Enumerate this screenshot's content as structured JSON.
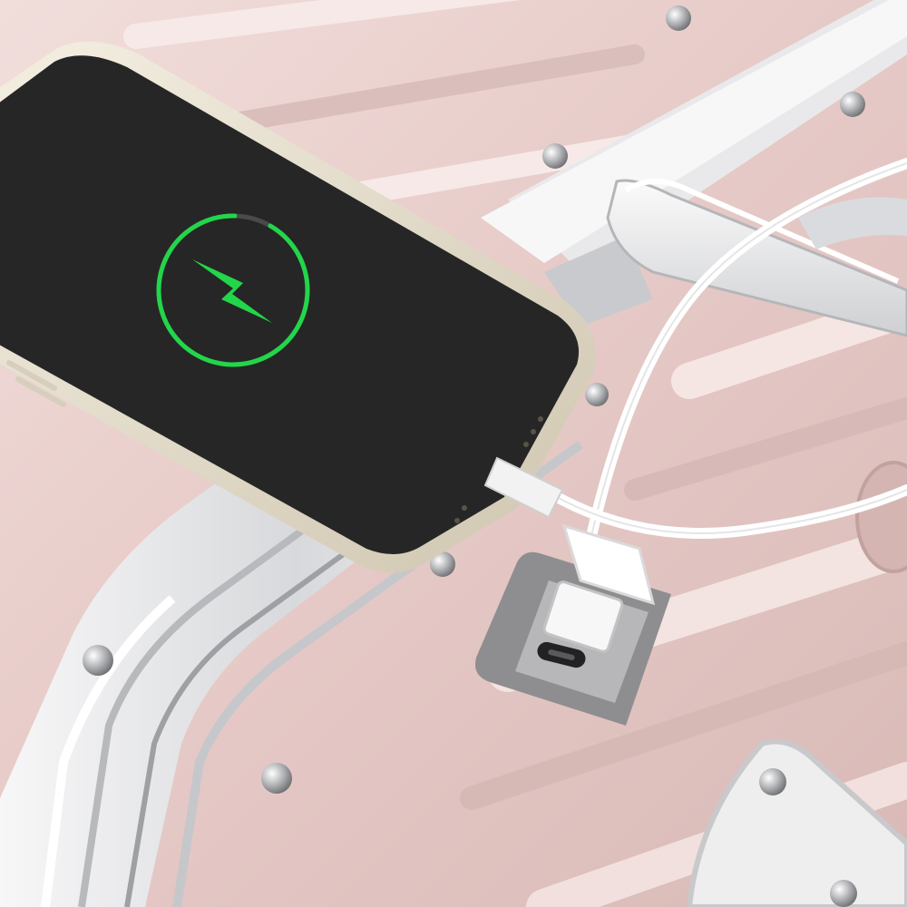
{
  "scene": {
    "subject": "phone-charging-on-luggage",
    "icons": {
      "charging": "lightning-bolt-icon",
      "usb_a": "usb-a-port-icon",
      "usb_c": "usb-c-port-icon"
    },
    "colors": {
      "shell": "#e9d2d0",
      "shell_shadow": "#c9a9a9",
      "aluminum": "#e4e4e6",
      "aluminum_dark": "#b9babd",
      "phone_screen": "#262626",
      "phone_frame": "#ece6d6",
      "charge_green": "#22d64a",
      "port_plate": "#8e8e90",
      "cable": "#ffffff"
    },
    "charge_ring_fill": 0.92
  }
}
